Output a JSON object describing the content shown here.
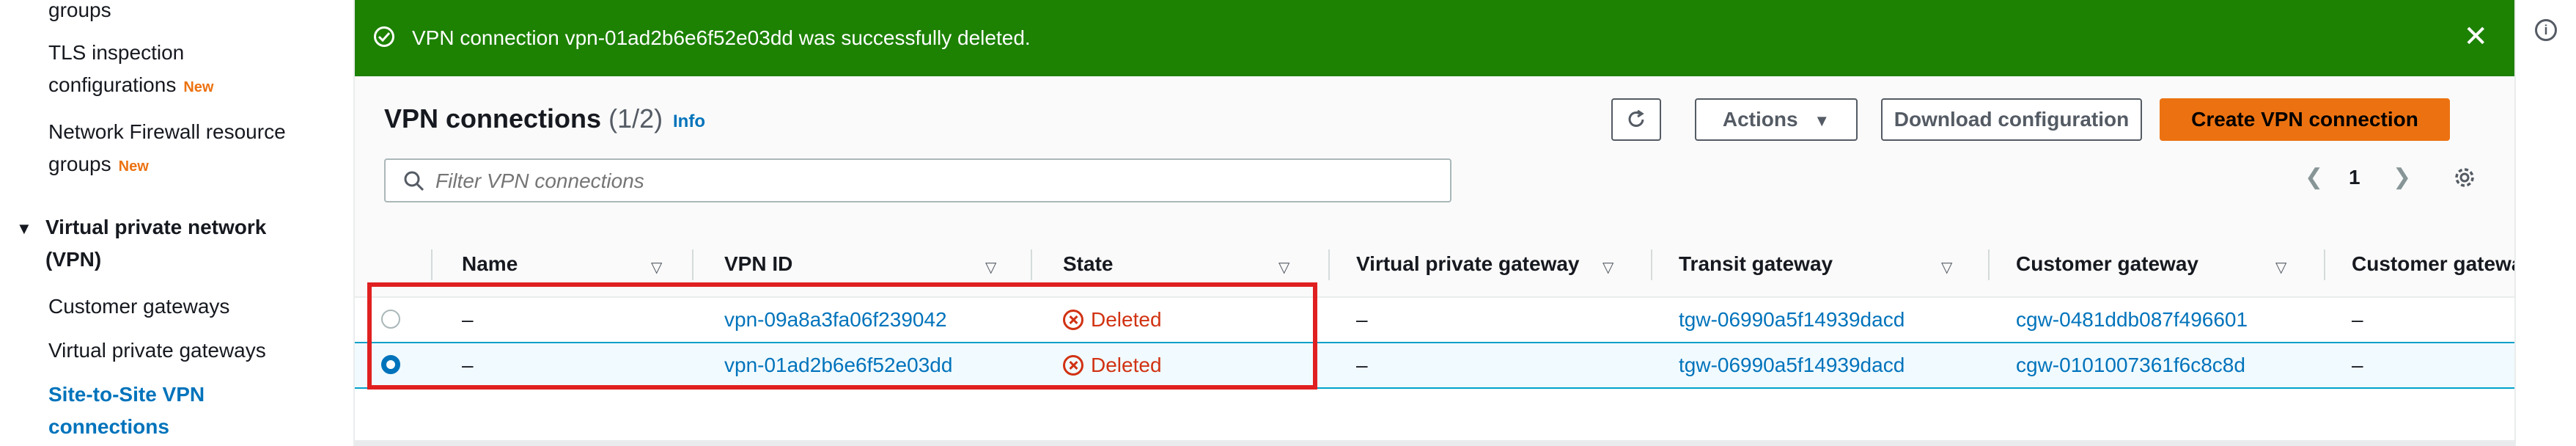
{
  "sidebar": {
    "items_top": [
      {
        "label": "groups"
      },
      {
        "label": "TLS inspection"
      },
      {
        "label": "configurations",
        "badge": "New"
      },
      {
        "label": "Network Firewall resource"
      },
      {
        "label": "groups",
        "badge": "New"
      }
    ],
    "section": {
      "label_line1": "Virtual private network",
      "label_line2": "(VPN)"
    },
    "section_items": [
      {
        "label": "Customer gateways"
      },
      {
        "label": "Virtual private gateways"
      },
      {
        "label": "Site-to-Site VPN",
        "label_line2": "connections",
        "active": true
      }
    ]
  },
  "flash": {
    "message": "VPN connection vpn-01ad2b6e6f52e03dd was successfully deleted.",
    "color": "#1d8102"
  },
  "header": {
    "title": "VPN connections",
    "count": "(1/2)",
    "info": "Info",
    "actions_label": "Actions",
    "download_label": "Download configuration",
    "create_label": "Create VPN connection"
  },
  "filter": {
    "placeholder": "Filter VPN connections"
  },
  "pagination": {
    "page": "1"
  },
  "table": {
    "columns": [
      "Name",
      "VPN ID",
      "State",
      "Virtual private gateway",
      "Transit gateway",
      "Customer gateway",
      "Customer gatewa"
    ],
    "rows": [
      {
        "selected": false,
        "name": "–",
        "vpn_id": "vpn-09a8a3fa06f239042",
        "state": "Deleted",
        "vgw": "–",
        "tgw": "tgw-06990a5f14939dacd",
        "cgw": "cgw-0481ddb087f496601",
        "cgw2": "–"
      },
      {
        "selected": true,
        "name": "–",
        "vpn_id": "vpn-01ad2b6e6f52e03dd",
        "state": "Deleted",
        "vgw": "–",
        "tgw": "tgw-06990a5f14939dacd",
        "cgw": "cgw-0101007361f6c8c8d",
        "cgw2": "–"
      }
    ]
  },
  "colors": {
    "accent": "#0073bb",
    "primary_button": "#ec7211",
    "deleted": "#d13212",
    "highlight": "#e02020"
  }
}
